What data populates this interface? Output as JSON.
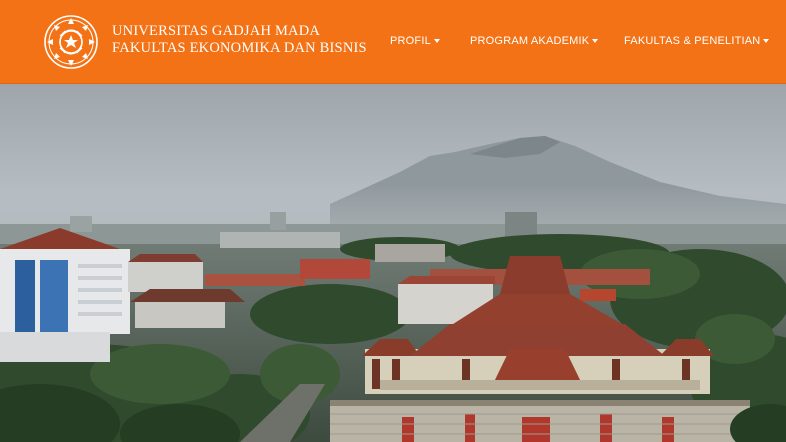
{
  "brand": {
    "line1": "UNIVERSITAS GADJAH MADA",
    "line2": "FAKULTAS EKONOMIKA DAN BISNIS",
    "logo_icon": "ugm-seal-icon",
    "color": "#f47216"
  },
  "nav": {
    "items": [
      {
        "label": "PROFIL",
        "icon": "caret-down-icon"
      },
      {
        "label": "PROGRAM AKADEMIK",
        "icon": "caret-down-icon"
      },
      {
        "label": "FAKULTAS & PENELITIAN",
        "icon": "caret-down-icon"
      }
    ]
  },
  "hero": {
    "image": "aerial-campus-photo"
  }
}
